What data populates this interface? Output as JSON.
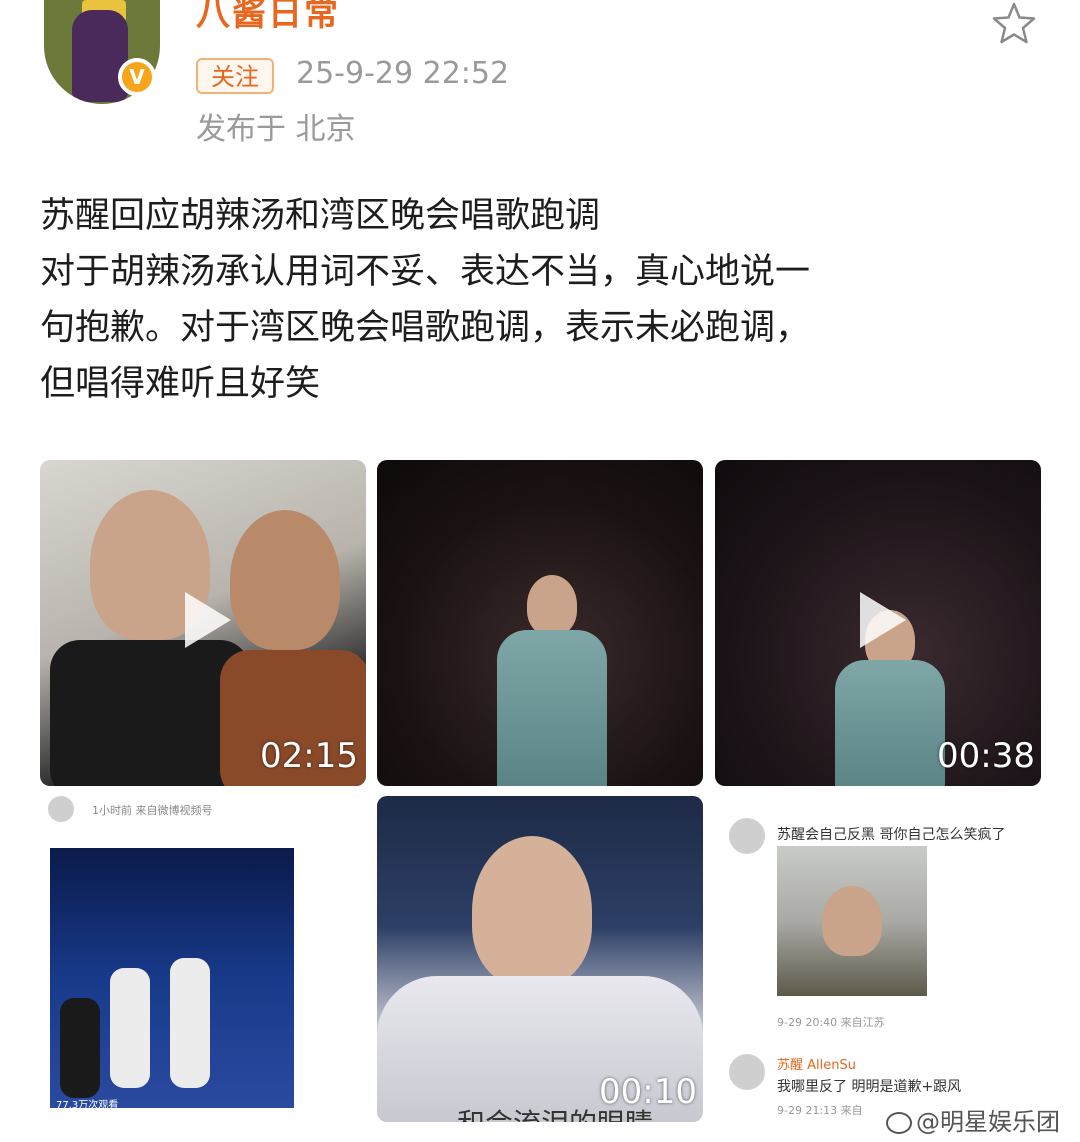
{
  "author": {
    "name": "八酱日常",
    "follow_label": "关注",
    "time": "25-9-29 22:52",
    "location": "发布于 北京",
    "verified_badge": "V"
  },
  "post": {
    "lines": [
      "苏醒回应胡辣汤和湾区晚会唱歌跑调",
      "对于胡辣汤承认用词不妥、表达不当，真心地说一",
      "句抱歉。对于湾区晚会唱歌跑调，表示未必跑调，",
      "但唱得难听且好笑"
    ]
  },
  "media": [
    {
      "type": "video",
      "duration": "02:15"
    },
    {
      "type": "image"
    },
    {
      "type": "video",
      "duration": "00:38"
    },
    {
      "type": "screenshot",
      "header": "1小时前  来自微博视频号",
      "views": "77.3万次观看"
    },
    {
      "type": "video",
      "duration": "00:10",
      "subtitle": "和会流泪的眼睛"
    },
    {
      "type": "screenshot",
      "comment": "苏醒会自己反黑 哥你自己怎么笑疯了",
      "comment_meta": "9-29 20:40  来自江苏",
      "reply_name": "苏醒 AllenSu",
      "reply": "我哪里反了 明明是道歉+跟风",
      "reply_meta": "9-29 21:13  来自"
    }
  ],
  "watermark": "@明星娱乐团",
  "colors": {
    "accent": "#e8661e",
    "meta": "#9a9a9a",
    "text": "#1d1d1d"
  }
}
